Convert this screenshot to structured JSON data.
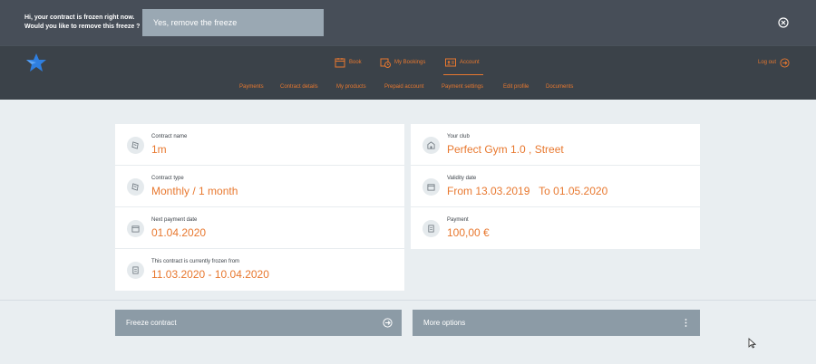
{
  "banner": {
    "message": "Hi, your contract is frozen right now. Would you like to remove this freeze ?",
    "button_label": "Yes, remove the freeze"
  },
  "nav": {
    "items": [
      {
        "label": "Book",
        "icon": "calendar-icon"
      },
      {
        "label": "My Bookings",
        "icon": "calendar-clock-icon"
      },
      {
        "label": "Account",
        "icon": "id-card-icon",
        "active": true
      }
    ],
    "logout_label": "Log out"
  },
  "subnav": {
    "items": [
      "Payments",
      "Contract details",
      "My products",
      "Prepaid account",
      "Payment settings",
      "Edit profile",
      "Documents"
    ]
  },
  "contract": {
    "fields": [
      {
        "label": "Contract name",
        "value": "1m",
        "icon": "ticket-icon"
      },
      {
        "label": "Contract type",
        "value": "Monthly / 1 month",
        "icon": "ticket-icon"
      },
      {
        "label": "Next payment date",
        "value": "01.04.2020",
        "icon": "calendar-icon"
      },
      {
        "label": "This contract is currently frozen from",
        "value": "11.03.2020 - 10.04.2020",
        "icon": "document-icon"
      }
    ]
  },
  "club": {
    "fields": [
      {
        "label": "Your club",
        "value": "Perfect Gym 1.0 , Street",
        "icon": "building-icon"
      },
      {
        "label": "Validity date",
        "value": "From 13.03.2019   To 01.05.2020",
        "icon": "calendar-icon"
      },
      {
        "label": "Payment",
        "value": "100,00 €",
        "icon": "document-icon"
      }
    ]
  },
  "actions": {
    "freeze_label": "Freeze contract",
    "more_label": "More options"
  },
  "colors": {
    "accent": "#e8782f",
    "header_bg": "#3b4249",
    "banner_bg": "#474e58",
    "page_bg": "#e9eef1",
    "action_bg": "#8c9ba6"
  }
}
